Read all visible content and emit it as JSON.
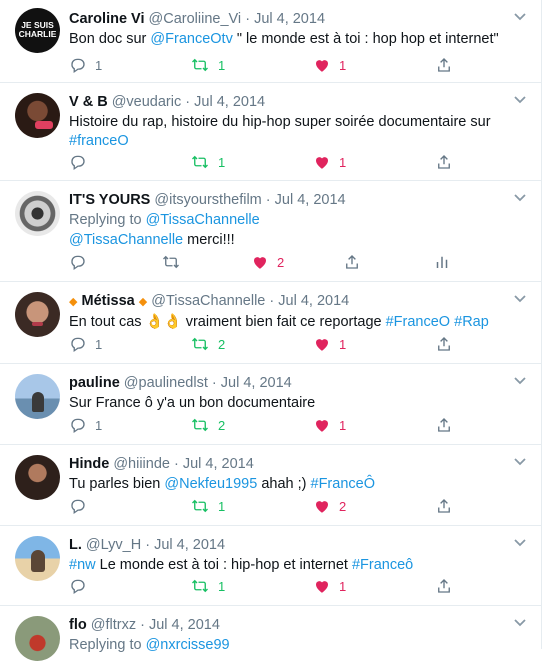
{
  "colors": {
    "link": "#1b95e0",
    "retweet": "#17bf63",
    "like": "#e0245e",
    "muted": "#657786"
  },
  "tweets": [
    {
      "name": "Caroline Vi",
      "handle": "@Caroliine_Vi",
      "sep": "·",
      "date": "Jul 4, 2014",
      "avatar_text_1": "JE SUIS",
      "avatar_text_2": "CHARLIE",
      "body_pre": "Bon doc sur ",
      "body_link": "@FranceOtv",
      "body_post": " \" le monde est à toi : hop hop et internet\"",
      "replies": "1",
      "retweets": "1",
      "likes": "1"
    },
    {
      "name": "V & B",
      "handle": "@veudaric",
      "sep": "·",
      "date": "Jul 4, 2014",
      "body_text": "Histoire du rap, histoire du hip-hop super soirée documentaire sur",
      "body_tag": "#franceO",
      "replies": "",
      "retweets": "1",
      "likes": "1"
    },
    {
      "name": "IT'S YOURS",
      "handle": "@itsyoursthefilm",
      "sep": "·",
      "date": "Jul 4, 2014",
      "replying_prefix": "Replying to ",
      "replying_to": "@TissaChannelle",
      "body_link": "@TissaChannelle",
      "body_post": " merci!!!",
      "replies": "",
      "retweets": "",
      "likes": "2"
    },
    {
      "name": "Métissa",
      "name_emoji": "◆",
      "handle": "@TissaChannelle",
      "sep": "·",
      "date": "Jul 4, 2014",
      "body_pre": "En tout cas ",
      "body_emoji": "👌👌",
      "body_mid": " vraiment bien fait ce reportage ",
      "body_tag1": "#FranceO",
      "body_tag2": "#Rap",
      "replies": "1",
      "retweets": "2",
      "likes": "1"
    },
    {
      "name": "pauline",
      "handle": "@paulinedlst",
      "sep": "·",
      "date": "Jul 4, 2014",
      "body_text": "Sur France ô y'a un bon documentaire",
      "replies": "1",
      "retweets": "2",
      "likes": "1"
    },
    {
      "name": "Hinde",
      "handle": "@hiiinde",
      "sep": "·",
      "date": "Jul 4, 2014",
      "body_pre": "Tu parles bien ",
      "body_link": "@Nekfeu1995",
      "body_mid": " ahah ;) ",
      "body_tag": "#FranceÔ",
      "replies": "",
      "retweets": "1",
      "likes": "2"
    },
    {
      "name": "L.",
      "handle": "@Lyv_H",
      "sep": "·",
      "date": "Jul 4, 2014",
      "body_tag1": "#nw",
      "body_mid": " Le monde est à toi : hip-hop et internet ",
      "body_tag2": "#Franceô",
      "replies": "",
      "retweets": "1",
      "likes": "1"
    },
    {
      "name": "flo",
      "handle": "@fltrxz",
      "sep": "·",
      "date": "Jul 4, 2014",
      "replying_prefix": "Replying to ",
      "replying_to": "@nxrcisse99"
    }
  ]
}
